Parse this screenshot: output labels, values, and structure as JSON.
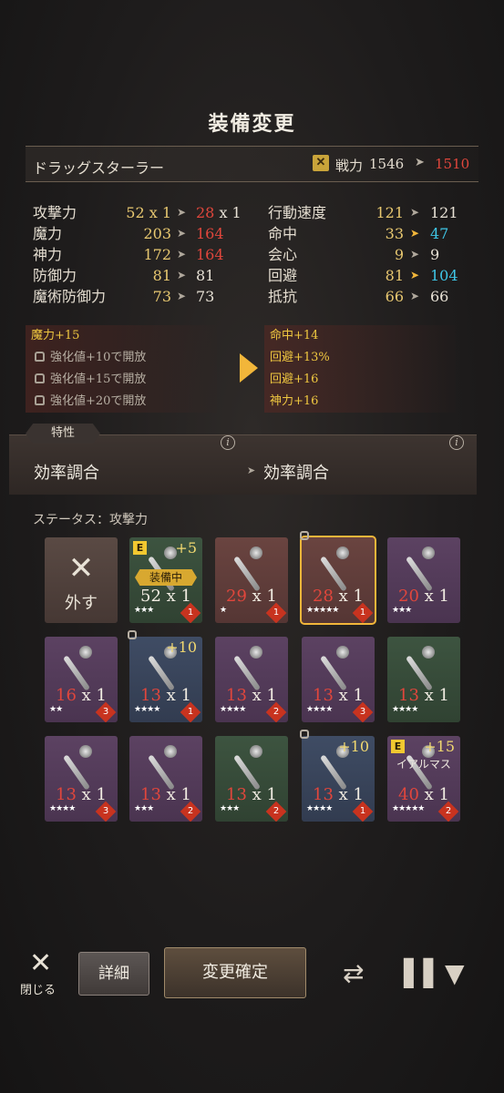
{
  "header": {
    "title": "装備変更"
  },
  "character": {
    "name": "ドラッグスターラー",
    "power_label": "戦力",
    "power_old": "1546",
    "power_new": "1510"
  },
  "stats_left": [
    {
      "label": "攻撃力",
      "old": "52 x 1",
      "new": "28",
      "new_suffix": " x 1"
    },
    {
      "label": "魔力",
      "old": "203",
      "new": "164"
    },
    {
      "label": "神力",
      "old": "172",
      "new": "164"
    },
    {
      "label": "防御力",
      "old": "81",
      "new": "81"
    },
    {
      "label": "魔術防御力",
      "old": "73",
      "new": "73"
    }
  ],
  "stats_right": [
    {
      "label": "行動速度",
      "old": "121",
      "new": "121"
    },
    {
      "label": "命中",
      "old": "33",
      "new": "47"
    },
    {
      "label": "会心",
      "old": "9",
      "new": "9"
    },
    {
      "label": "回避",
      "old": "81",
      "new": "104"
    },
    {
      "label": "抵抗",
      "old": "66",
      "new": "66"
    }
  ],
  "bonuses_left": [
    {
      "text": "魔力+15"
    },
    {
      "text": "強化値+10で開放"
    },
    {
      "text": "強化値+15で開放"
    },
    {
      "text": "強化値+20で開放"
    }
  ],
  "bonuses_right": [
    {
      "text": "命中+14"
    },
    {
      "text": "回避+13%"
    },
    {
      "text": "回避+16"
    },
    {
      "text": "神力+16"
    }
  ],
  "trait": {
    "header": "特性",
    "left": "効率調合",
    "right": "効率調合",
    "info_glyph": "i"
  },
  "status_label": "ステータス：攻撃力",
  "remove_card": {
    "label": "外す"
  },
  "cards": [
    {
      "value": "52",
      "mult": " x 1",
      "stars": "★★★",
      "badge": "1",
      "plus": "+5",
      "e": "E",
      "tag": "装備中"
    },
    {
      "value": "29",
      "mult": " x 1",
      "stars": "★",
      "badge": "1"
    },
    {
      "value": "28",
      "mult": " x 1",
      "stars": "★★★★★",
      "badge": "1"
    },
    {
      "value": "20",
      "mult": " x 1",
      "stars": "★★★"
    },
    {
      "value": "16",
      "mult": " x 1",
      "stars": "★★",
      "badge": "3"
    },
    {
      "value": "13",
      "mult": " x 1",
      "stars": "★★★★",
      "badge": "1",
      "plus": "+10"
    },
    {
      "value": "13",
      "mult": " x 1",
      "stars": "★★★★",
      "badge": "2"
    },
    {
      "value": "13",
      "mult": " x 1",
      "stars": "★★★★",
      "badge": "3"
    },
    {
      "value": "13",
      "mult": " x 1",
      "stars": "★★★★"
    },
    {
      "value": "13",
      "mult": " x 1",
      "stars": "★★★★",
      "badge": "3"
    },
    {
      "value": "13",
      "mult": " x 1",
      "stars": "★★★",
      "badge": "2"
    },
    {
      "value": "13",
      "mult": " x 1",
      "stars": "★★★",
      "badge": "2"
    },
    {
      "value": "13",
      "mult": " x 1",
      "stars": "★★★★",
      "badge": "1",
      "plus": "+10"
    },
    {
      "value": "40",
      "mult": " x 1",
      "stars": "★★★★★",
      "badge": "2",
      "plus": "+15",
      "e": "E",
      "tag": "イアルマス"
    }
  ],
  "footer": {
    "close_label": "閉じる",
    "detail_label": "詳細",
    "confirm_label": "変更確定"
  },
  "colors": {
    "gold": "#f2b63a",
    "red": "#e0463c",
    "cyan": "#3fc6e6"
  }
}
